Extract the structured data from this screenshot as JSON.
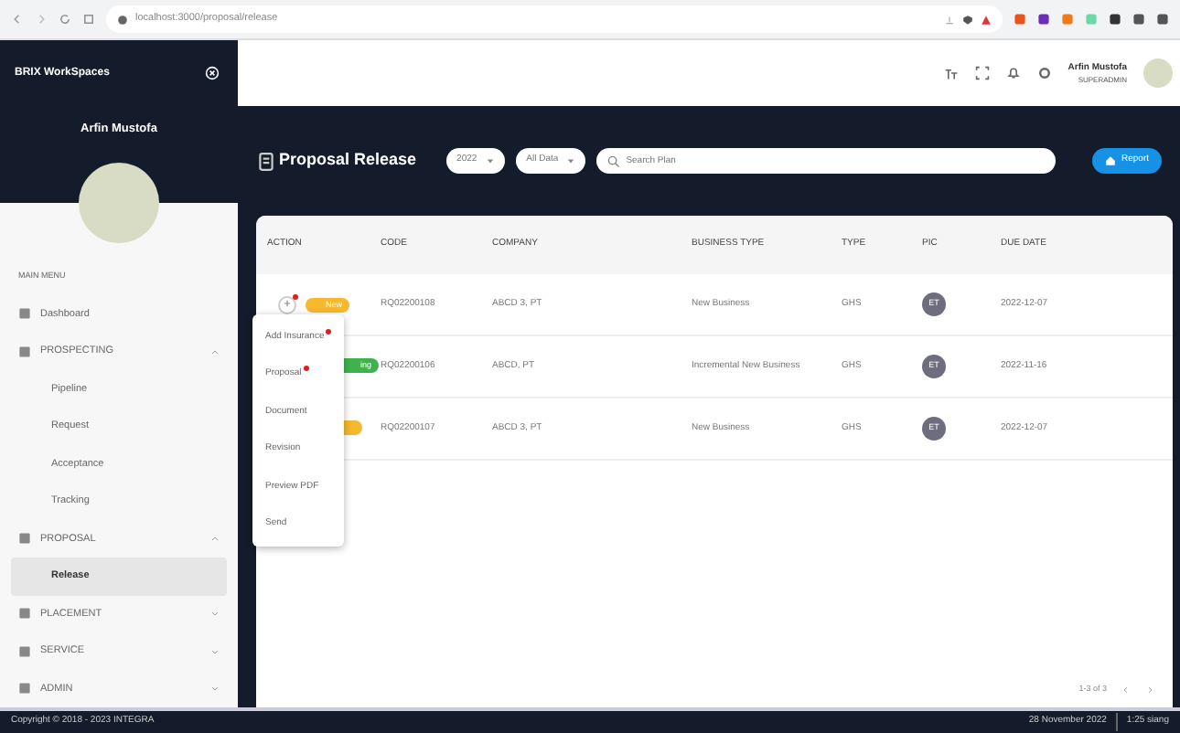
{
  "browser": {
    "url": "localhost:3000/proposal/release"
  },
  "sidebar": {
    "brand": "BRIX WorkSpaces",
    "user_name": "Arfin Mustofa",
    "section": "MAIN MENU",
    "items": [
      {
        "label": "Dashboard",
        "selected": false
      },
      {
        "label": "PROSPECTING",
        "expanded": true,
        "selected": false,
        "children": [
          {
            "label": "Pipeline",
            "selected": false
          },
          {
            "label": "Request",
            "selected": false
          },
          {
            "label": "Acceptance",
            "selected": false
          },
          {
            "label": "Tracking",
            "selected": false
          }
        ]
      },
      {
        "label": "PROPOSAL",
        "expanded": true,
        "selected": false,
        "children": [
          {
            "label": "Release",
            "selected": true
          }
        ]
      },
      {
        "label": "PLACEMENT",
        "expanded": false,
        "selected": false
      },
      {
        "label": "SERVICE",
        "expanded": false,
        "selected": false
      },
      {
        "label": "ADMIN",
        "expanded": false,
        "selected": false
      }
    ]
  },
  "topbar": {
    "user_name": "Arfin Mustofa",
    "role": "SUPERADMIN"
  },
  "page": {
    "title": "Proposal Release",
    "year": "2022",
    "filter": "All Data",
    "search": {
      "placeholder": "Search Plan"
    },
    "report_button": "Report"
  },
  "table": {
    "columns": [
      "ACTION",
      "CODE",
      "COMPANY",
      "BUSINESS TYPE",
      "TYPE",
      "PIC",
      "DUE DATE"
    ],
    "rows": [
      {
        "action_button": true,
        "status": "New",
        "color": "#f5b82e",
        "code": "RQ02200108",
        "company": "ABCD 3, PT",
        "business_type": "New Business",
        "type": "GHS",
        "pic": "ET",
        "due_date": "2022-12-07"
      },
      {
        "status": "ing",
        "color": "#3fb24f",
        "code": "RQ02200106",
        "company": "ABCD, PT",
        "business_type": "Incremental New Business",
        "type": "GHS",
        "pic": "ET",
        "due_date": "2022-11-16"
      },
      {
        "color": "#f5b82e",
        "code": "RQ02200107",
        "company": "ABCD 3, PT",
        "business_type": "New Business",
        "type": "GHS",
        "pic": "ET",
        "due_date": "2022-12-07"
      }
    ],
    "pagination": "1-3 of 3"
  },
  "action_menu": [
    {
      "label": "Add Insurance",
      "alert": true
    },
    {
      "label": "Proposal",
      "alert": true
    },
    {
      "label": "Document",
      "alert": false
    },
    {
      "label": "Revision",
      "alert": false
    },
    {
      "label": "Preview PDF",
      "alert": false
    },
    {
      "label": "Send",
      "alert": false
    }
  ],
  "footer": {
    "copyright": "Copyright © 2018 - 2023 INTEGRA",
    "date": "28 November 2022",
    "time": "1:25 siang"
  }
}
